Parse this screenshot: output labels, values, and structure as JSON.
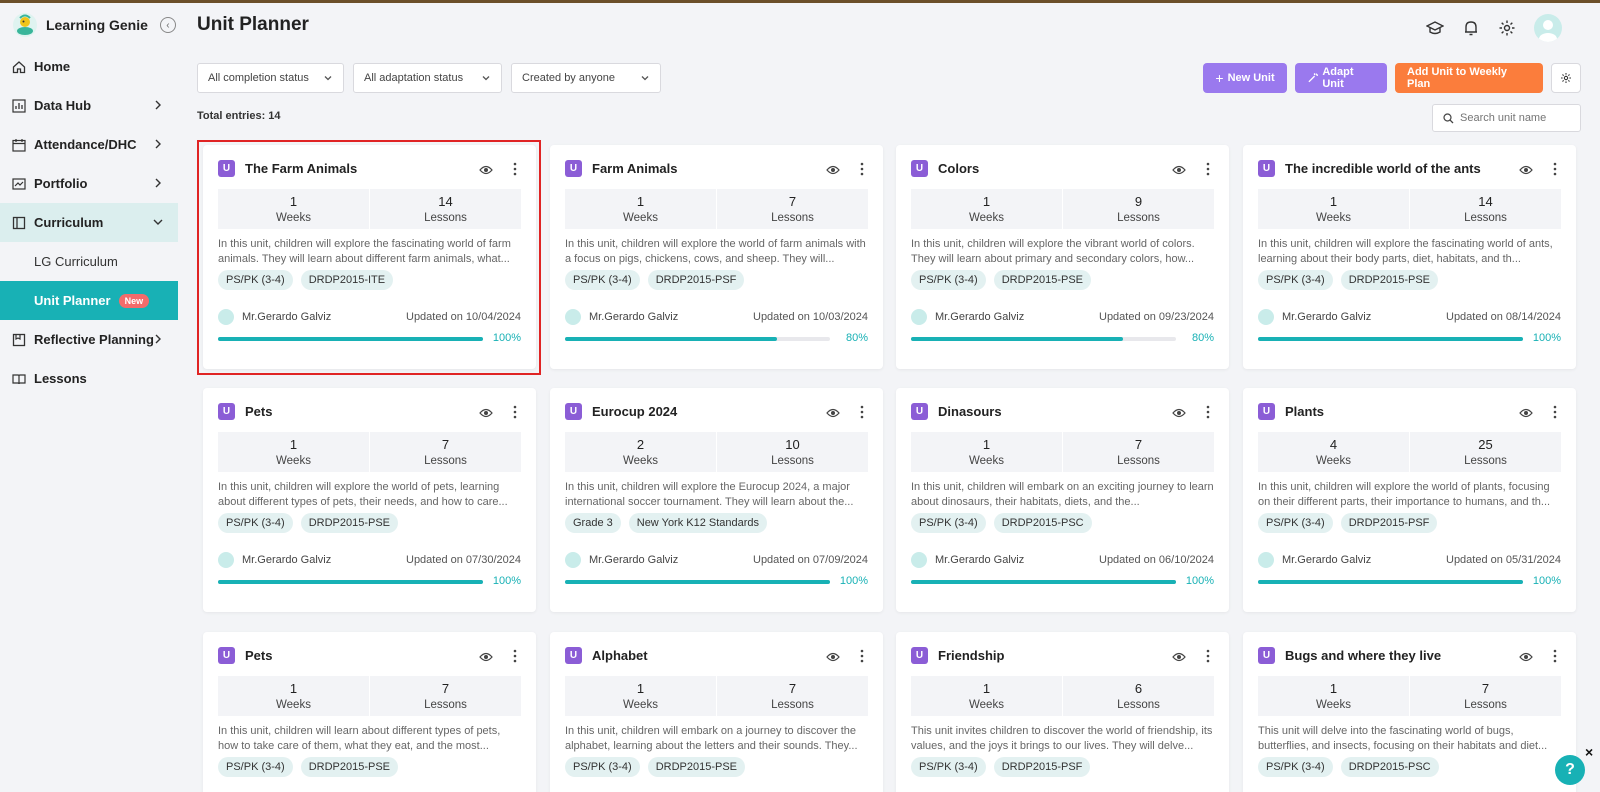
{
  "app": {
    "name": "Learning Genie"
  },
  "sidebar": {
    "items": [
      {
        "label": "Home",
        "icon": "home-icon"
      },
      {
        "label": "Data Hub",
        "icon": "chart-icon"
      },
      {
        "label": "Attendance/DHC",
        "icon": "calendar-icon"
      },
      {
        "label": "Portfolio",
        "icon": "portfolio-icon"
      },
      {
        "label": "Curriculum",
        "icon": "book-icon"
      },
      {
        "label": "Reflective Planning",
        "icon": "reflect-icon"
      },
      {
        "label": "Lessons",
        "icon": "lessons-icon"
      }
    ],
    "sub_items": [
      {
        "label": "LG Curriculum"
      },
      {
        "label": "Unit Planner",
        "badge": "New"
      }
    ]
  },
  "header": {
    "title": "Unit Planner"
  },
  "filters": {
    "completion": "All completion status",
    "adaptation": "All adaptation status",
    "creator": "Created by anyone"
  },
  "actions": {
    "new_unit": "New Unit",
    "adapt_unit": "Adapt Unit",
    "add_weekly": "Add Unit to Weekly Plan"
  },
  "total": "Total entries: 14",
  "search": {
    "placeholder": "Search unit name"
  },
  "cards": [
    {
      "title": "The Farm Animals",
      "weeks": "1",
      "weeks_label": "Weeks",
      "lessons": "14",
      "lessons_label": "Lessons",
      "desc": "In this unit, children will explore the fascinating world of farm animals. They will learn about different farm animals, what...",
      "tags": [
        "PS/PK (3-4)",
        "DRDP2015-ITE"
      ],
      "author": "Mr.Gerardo Galviz",
      "updated": "Updated on 10/04/2024",
      "progress": 100,
      "pct": "100%"
    },
    {
      "title": "Farm Animals",
      "weeks": "1",
      "weeks_label": "Weeks",
      "lessons": "7",
      "lessons_label": "Lessons",
      "desc": "In this unit, children will explore the world of farm animals with a focus on pigs, chickens, cows, and sheep. They will...",
      "tags": [
        "PS/PK (3-4)",
        "DRDP2015-PSF"
      ],
      "author": "Mr.Gerardo Galviz",
      "updated": "Updated on 10/03/2024",
      "progress": 80,
      "pct": "80%"
    },
    {
      "title": "Colors",
      "weeks": "1",
      "weeks_label": "Weeks",
      "lessons": "9",
      "lessons_label": "Lessons",
      "desc": "In this unit, children will explore the vibrant world of colors. They will learn about primary and secondary colors, how...",
      "tags": [
        "PS/PK (3-4)",
        "DRDP2015-PSE"
      ],
      "author": "Mr.Gerardo Galviz",
      "updated": "Updated on 09/23/2024",
      "progress": 80,
      "pct": "80%"
    },
    {
      "title": "The incredible world of the ants",
      "weeks": "1",
      "weeks_label": "Weeks",
      "lessons": "14",
      "lessons_label": "Lessons",
      "desc": "In this unit, children will explore the fascinating world of ants, learning about their body parts, diet, habitats, and th...",
      "tags": [
        "PS/PK (3-4)",
        "DRDP2015-PSE"
      ],
      "author": "Mr.Gerardo Galviz",
      "updated": "Updated on 08/14/2024",
      "progress": 100,
      "pct": "100%"
    },
    {
      "title": "Pets",
      "weeks": "1",
      "weeks_label": "Weeks",
      "lessons": "7",
      "lessons_label": "Lessons",
      "desc": "In this unit, children will explore the world of pets, learning about different types of pets, their needs, and how to care...",
      "tags": [
        "PS/PK (3-4)",
        "DRDP2015-PSE"
      ],
      "author": "Mr.Gerardo Galviz",
      "updated": "Updated on 07/30/2024",
      "progress": 100,
      "pct": "100%"
    },
    {
      "title": "Eurocup 2024",
      "weeks": "2",
      "weeks_label": "Weeks",
      "lessons": "10",
      "lessons_label": "Lessons",
      "desc": "In this unit, children will explore the Eurocup 2024, a major international soccer tournament. They will learn about the...",
      "tags": [
        "Grade 3",
        "New York K12 Standards"
      ],
      "author": "Mr.Gerardo Galviz",
      "updated": "Updated on 07/09/2024",
      "progress": 100,
      "pct": "100%"
    },
    {
      "title": "Dinasours",
      "weeks": "1",
      "weeks_label": "Weeks",
      "lessons": "7",
      "lessons_label": "Lessons",
      "desc": "In this unit, children will embark on an exciting journey to learn about dinosaurs, their habitats, diets, and the...",
      "tags": [
        "PS/PK (3-4)",
        "DRDP2015-PSC"
      ],
      "author": "Mr.Gerardo Galviz",
      "updated": "Updated on 06/10/2024",
      "progress": 100,
      "pct": "100%"
    },
    {
      "title": "Plants",
      "weeks": "4",
      "weeks_label": "Weeks",
      "lessons": "25",
      "lessons_label": "Lessons",
      "desc": "In this unit, children will explore the world of plants, focusing on their different parts, their importance to humans, and th...",
      "tags": [
        "PS/PK (3-4)",
        "DRDP2015-PSF"
      ],
      "author": "Mr.Gerardo Galviz",
      "updated": "Updated on 05/31/2024",
      "progress": 100,
      "pct": "100%"
    },
    {
      "title": "Pets",
      "weeks": "1",
      "weeks_label": "Weeks",
      "lessons": "7",
      "lessons_label": "Lessons",
      "desc": "In this unit, children will learn about different types of pets, how to take care of them, what they eat, and the most...",
      "tags": [
        "PS/PK (3-4)",
        "DRDP2015-PSE"
      ]
    },
    {
      "title": "Alphabet",
      "weeks": "1",
      "weeks_label": "Weeks",
      "lessons": "7",
      "lessons_label": "Lessons",
      "desc": "In this unit, children will embark on a journey to discover the alphabet, learning about the letters and their sounds. They...",
      "tags": [
        "PS/PK (3-4)",
        "DRDP2015-PSE"
      ]
    },
    {
      "title": "Friendship",
      "weeks": "1",
      "weeks_label": "Weeks",
      "lessons": "6",
      "lessons_label": "Lessons",
      "desc": "This unit invites children to discover the world of friendship, its values, and the joys it brings to our lives. They will delve...",
      "tags": [
        "PS/PK (3-4)",
        "DRDP2015-PSF"
      ]
    },
    {
      "title": "Bugs and where they live",
      "weeks": "1",
      "weeks_label": "Weeks",
      "lessons": "7",
      "lessons_label": "Lessons",
      "desc": "This unit will delve into the fascinating world of bugs, butterflies, and insects, focusing on their habitats and diet...",
      "tags": [
        "PS/PK (3-4)",
        "DRDP2015-PSC"
      ]
    }
  ],
  "help": {
    "label": "?",
    "close": "×"
  },
  "colors": {
    "accent": "#18b1b5",
    "purple": "#9a79ee",
    "orange": "#fb7d3c",
    "highlight": "#e02424"
  }
}
